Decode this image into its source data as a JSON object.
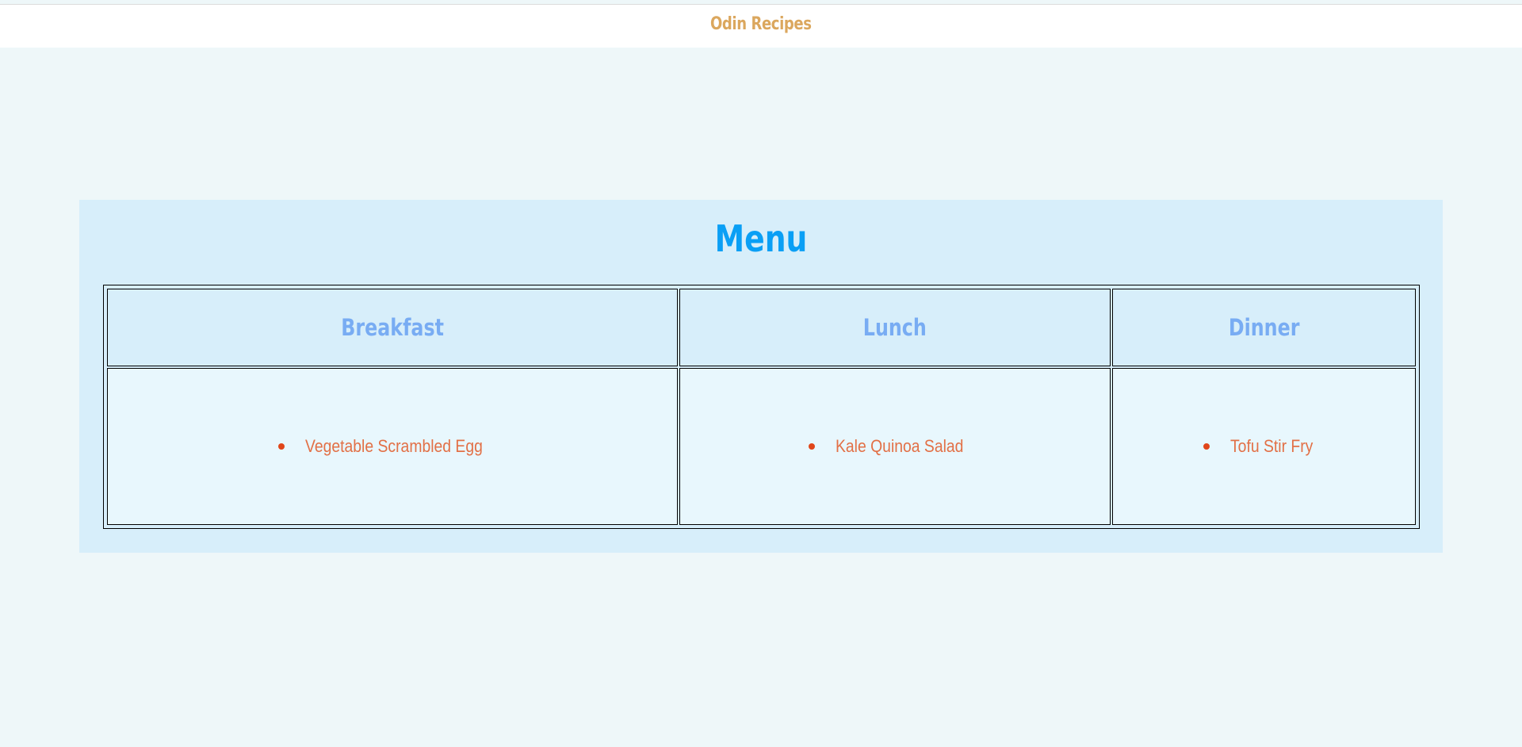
{
  "header": {
    "title": "Odin Recipes"
  },
  "menu": {
    "title": "Menu",
    "columns": [
      {
        "heading": "Breakfast",
        "items": [
          "Vegetable Scrambled Egg"
        ]
      },
      {
        "heading": "Lunch",
        "items": [
          "Kale Quinoa Salad"
        ]
      },
      {
        "heading": "Dinner",
        "items": [
          "Tofu Stir Fry"
        ]
      }
    ]
  },
  "colors": {
    "page_bg": "#eef7f9",
    "header_bg": "#ffffff",
    "header_title": "#dba75e",
    "panel_bg": "#d7eefa",
    "menu_title": "#0a9ff5",
    "column_heading": "#78acf3",
    "item_text": "#e27046",
    "bullet": "#e0461a"
  }
}
